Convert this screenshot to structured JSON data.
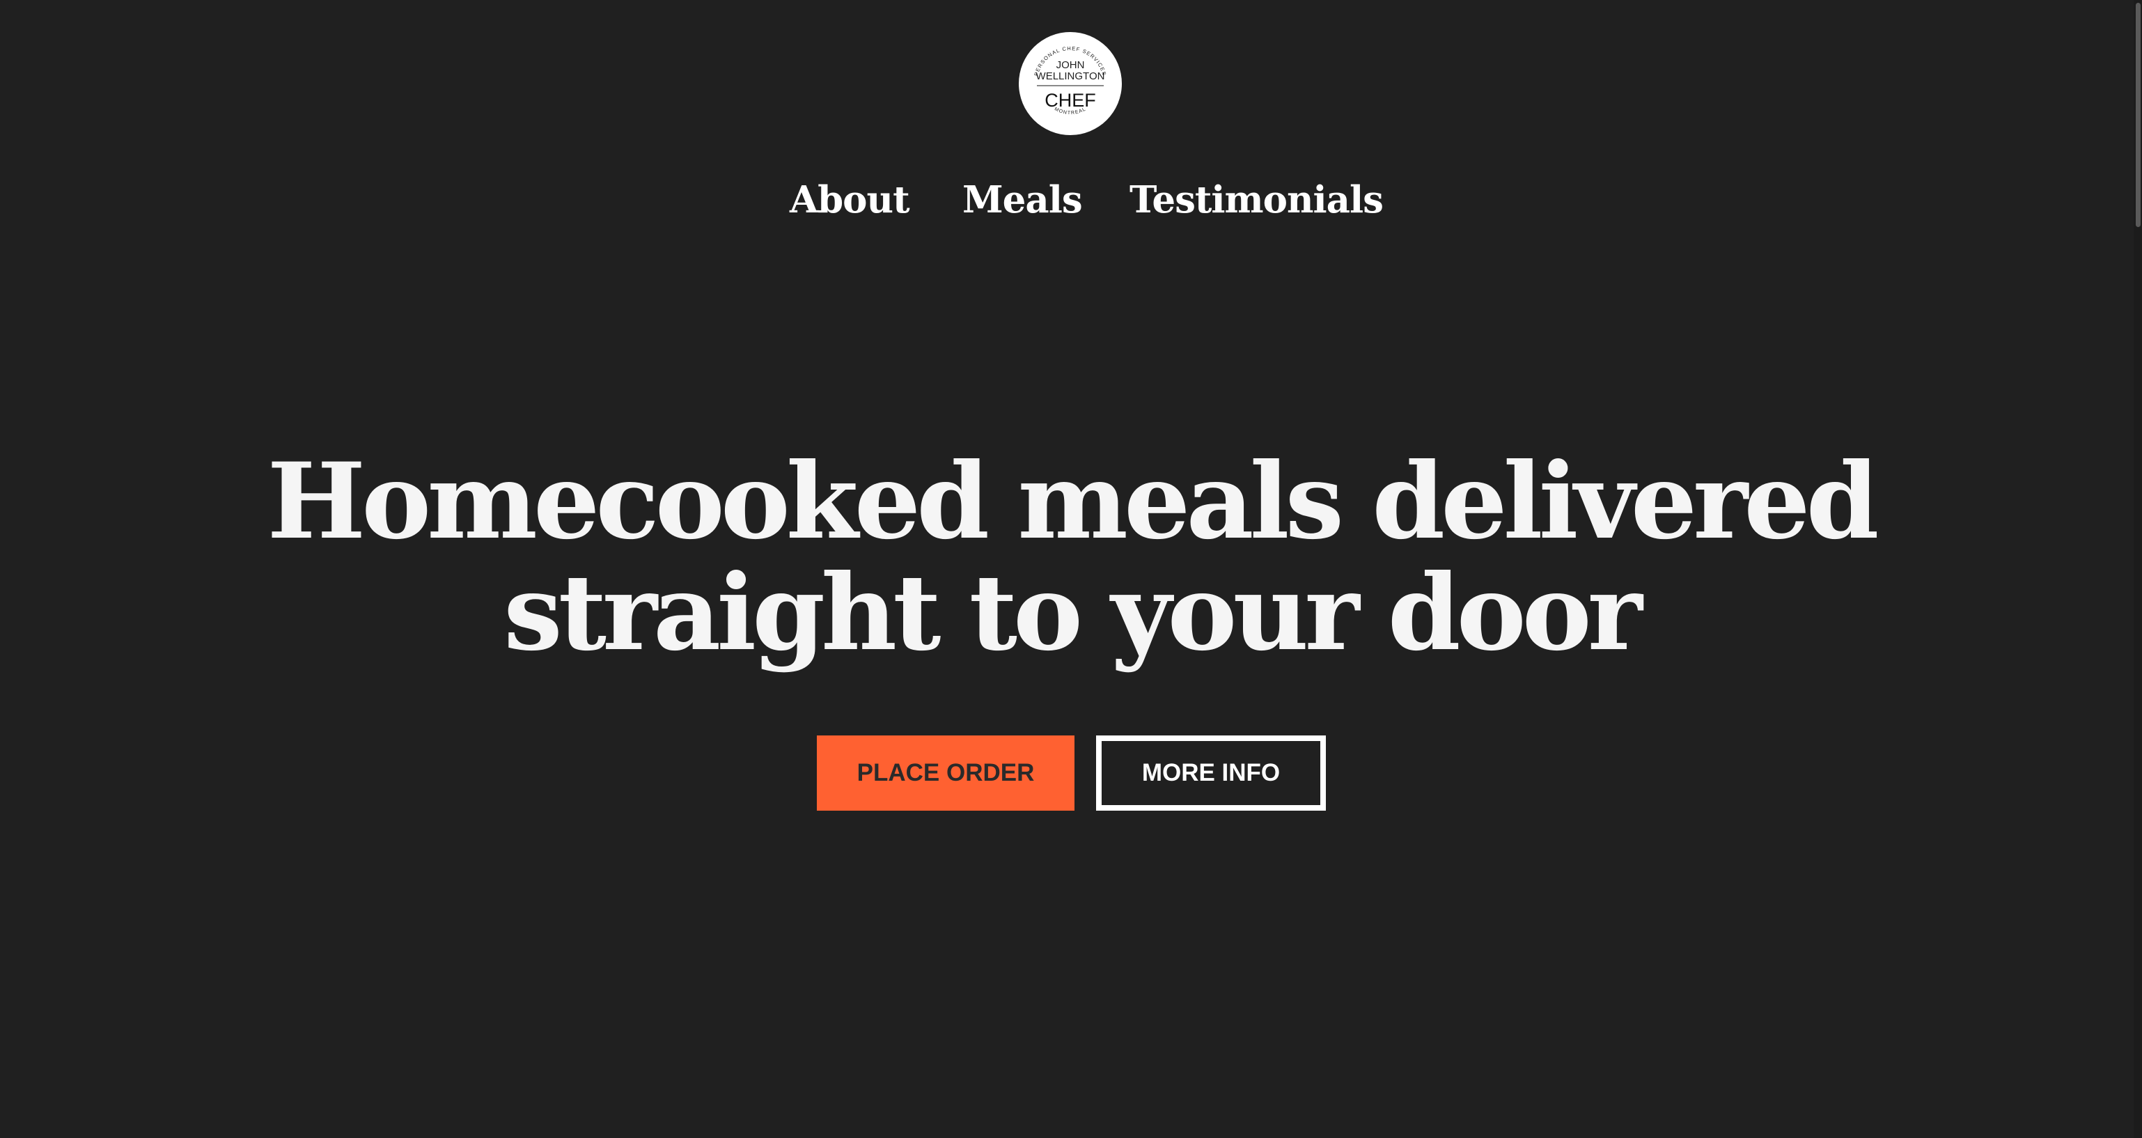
{
  "logo": {
    "top_arc": "PERSONAL CHEF SERVICES",
    "line1": "JOHN",
    "line2": "WELLINGTON",
    "main": "CHEF",
    "bottom_arc": "MONTREAL"
  },
  "nav": {
    "items": [
      {
        "label": "About"
      },
      {
        "label": "Meals"
      },
      {
        "label": "Testimonials"
      }
    ]
  },
  "hero": {
    "title_line1": "Homecooked meals delivered",
    "title_line2": "straight to your door"
  },
  "buttons": {
    "order_label": "PLACE ORDER",
    "info_label": "MORE INFO"
  },
  "colors": {
    "background": "#202020",
    "accent": "#ff6131",
    "text": "#f5f5f5"
  }
}
